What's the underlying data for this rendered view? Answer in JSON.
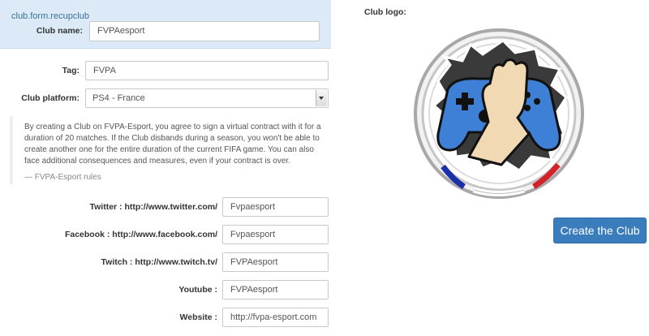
{
  "recup": {
    "title": "club.form.recupclub"
  },
  "fields": {
    "club_name": {
      "label": "Club name:",
      "value": "FVPAesport"
    },
    "tag": {
      "label": "Tag:",
      "value": "FVPA"
    },
    "platform": {
      "label": "Club platform:",
      "value": "PS4 - France"
    },
    "twitter": {
      "label": "Twitter : http://www.twitter.com/",
      "value": "Fvpaesport"
    },
    "facebook": {
      "label": "Facebook : http://www.facebook.com/",
      "value": "Fvpaesport"
    },
    "twitch": {
      "label": "Twitch : http://www.twitch.tv/",
      "value": "FVPAesport"
    },
    "youtube": {
      "label": "Youtube :",
      "value": "FVPAesport"
    },
    "website": {
      "label": "Website :",
      "value": "http://fvpa-esport.com"
    }
  },
  "notice": {
    "text": "By creating a Club on FVPA-Esport, you agree to sign a virtual contract with it for a duration of 20 matches. If the Club disbands during a season, you won't be able to create another one for the entire duration of the current FIFA game. You can also face additional consequences and measures, even if your contract is over.",
    "footer": "— FVPA-Esport rules"
  },
  "logo": {
    "label": "Club logo:",
    "icon": "club-logo-controller-fist"
  },
  "actions": {
    "create_label": "Create the Club"
  },
  "colors": {
    "accent": "#3a7dbd",
    "recup_bg": "#dbeaf6",
    "controller": "#3d80d6",
    "france_blue": "#1b2fa8",
    "france_red": "#d2232a"
  }
}
